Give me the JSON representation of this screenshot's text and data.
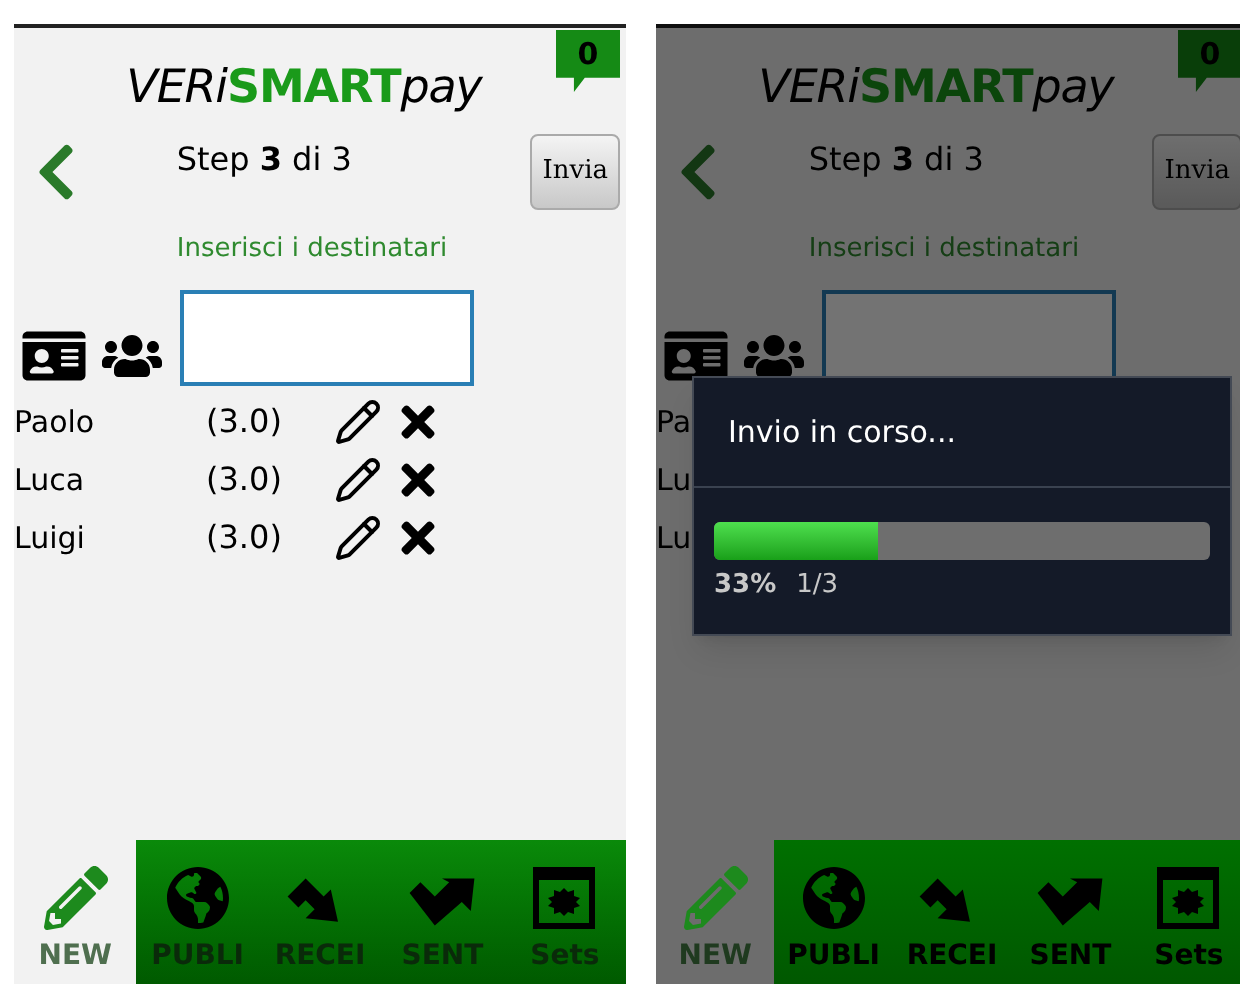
{
  "screens": [
    {
      "logo": {
        "prefix": "VERi",
        "highlight": "SMART",
        "suffix": "pay"
      },
      "badge": "0",
      "step": "Step **3** di 3",
      "send_button": "Invia",
      "hint": "Inserisci i destinatari",
      "contacts": [
        {
          "name": "Paolo",
          "score": "(3.0)"
        },
        {
          "name": "Luca",
          "score": "(3.0)"
        },
        {
          "name": "Luigi",
          "score": "(3.0)"
        }
      ],
      "nav_tabs": [
        {
          "label": "NEW",
          "selected": true
        },
        {
          "label": "PUBLI",
          "selected": false
        },
        {
          "label": "RECEI",
          "selected": false
        },
        {
          "label": "SENT",
          "selected": false
        },
        {
          "label": "Sets",
          "selected": false
        }
      ]
    },
    {
      "logo": {
        "prefix": "VERi",
        "highlight": "SMART",
        "suffix": "pay"
      },
      "badge": "0",
      "step": "Step **3** di 3",
      "send_button": "Invia",
      "hint": "Inserisci i destinatari",
      "contacts": [
        {
          "name": "Pa"
        },
        {
          "name": "Lu"
        },
        {
          "name": "Lu"
        }
      ],
      "nav_tabs": [
        {
          "label": "NEW",
          "selected": true
        },
        {
          "label": "PUBLI",
          "selected": false
        },
        {
          "label": "RECEI",
          "selected": false
        },
        {
          "label": "SENT",
          "selected": false
        },
        {
          "label": "Sets",
          "selected": false
        }
      ],
      "dialog": {
        "title": "Invio in corso...",
        "level": 0.33,
        "percent": "33%",
        "count": "1/3"
      }
    }
  ]
}
